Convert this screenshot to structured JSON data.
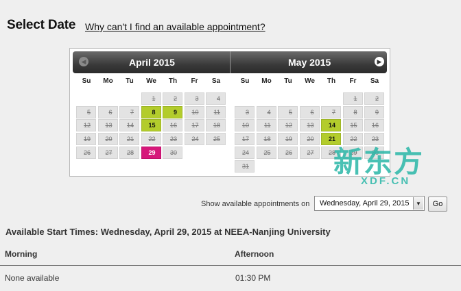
{
  "header": {
    "title": "Select Date",
    "help_link": "Why can't I find an available appointment?"
  },
  "calendar": {
    "weekdays": [
      "Su",
      "Mo",
      "Tu",
      "We",
      "Th",
      "Fr",
      "Sa"
    ],
    "months": [
      {
        "title": "April 2015",
        "weeks": [
          [
            null,
            null,
            null,
            {
              "d": "1",
              "s": "past"
            },
            {
              "d": "2",
              "s": "past"
            },
            {
              "d": "3",
              "s": "past"
            },
            {
              "d": "4",
              "s": "past"
            }
          ],
          [
            {
              "d": "5",
              "s": "past"
            },
            {
              "d": "6",
              "s": "past"
            },
            {
              "d": "7",
              "s": "past"
            },
            {
              "d": "8",
              "s": "available"
            },
            {
              "d": "9",
              "s": "available"
            },
            {
              "d": "10",
              "s": "past"
            },
            {
              "d": "11",
              "s": "past"
            }
          ],
          [
            {
              "d": "12",
              "s": "past"
            },
            {
              "d": "13",
              "s": "past"
            },
            {
              "d": "14",
              "s": "past"
            },
            {
              "d": "15",
              "s": "available"
            },
            {
              "d": "16",
              "s": "past"
            },
            {
              "d": "17",
              "s": "past"
            },
            {
              "d": "18",
              "s": "past"
            }
          ],
          [
            {
              "d": "19",
              "s": "past"
            },
            {
              "d": "20",
              "s": "past"
            },
            {
              "d": "21",
              "s": "past"
            },
            {
              "d": "22",
              "s": "past"
            },
            {
              "d": "23",
              "s": "past"
            },
            {
              "d": "24",
              "s": "past"
            },
            {
              "d": "25",
              "s": "past"
            }
          ],
          [
            {
              "d": "26",
              "s": "past"
            },
            {
              "d": "27",
              "s": "past"
            },
            {
              "d": "28",
              "s": "past"
            },
            {
              "d": "29",
              "s": "selected"
            },
            {
              "d": "30",
              "s": "past"
            },
            null,
            null
          ]
        ]
      },
      {
        "title": "May 2015",
        "weeks": [
          [
            null,
            null,
            null,
            null,
            null,
            {
              "d": "1",
              "s": "past"
            },
            {
              "d": "2",
              "s": "past"
            }
          ],
          [
            {
              "d": "3",
              "s": "past"
            },
            {
              "d": "4",
              "s": "past"
            },
            {
              "d": "5",
              "s": "past"
            },
            {
              "d": "6",
              "s": "past"
            },
            {
              "d": "7",
              "s": "past"
            },
            {
              "d": "8",
              "s": "past"
            },
            {
              "d": "9",
              "s": "past"
            }
          ],
          [
            {
              "d": "10",
              "s": "past"
            },
            {
              "d": "11",
              "s": "past"
            },
            {
              "d": "12",
              "s": "past"
            },
            {
              "d": "13",
              "s": "past"
            },
            {
              "d": "14",
              "s": "available"
            },
            {
              "d": "15",
              "s": "past"
            },
            {
              "d": "16",
              "s": "past"
            }
          ],
          [
            {
              "d": "17",
              "s": "past"
            },
            {
              "d": "18",
              "s": "past"
            },
            {
              "d": "19",
              "s": "past"
            },
            {
              "d": "20",
              "s": "past"
            },
            {
              "d": "21",
              "s": "available"
            },
            {
              "d": "22",
              "s": "past"
            },
            {
              "d": "23",
              "s": "past"
            }
          ],
          [
            {
              "d": "24",
              "s": "past"
            },
            {
              "d": "25",
              "s": "past"
            },
            {
              "d": "26",
              "s": "past"
            },
            {
              "d": "27",
              "s": "past"
            },
            {
              "d": "28",
              "s": "past"
            },
            {
              "d": "29",
              "s": "past"
            },
            {
              "d": "30",
              "s": "past"
            }
          ],
          [
            {
              "d": "31",
              "s": "past"
            },
            null,
            null,
            null,
            null,
            null,
            null
          ]
        ]
      }
    ],
    "prev_icon": "chevron-left-icon",
    "next_icon": "chevron-right-icon"
  },
  "controls": {
    "show_label": "Show available appointments on",
    "date_value": "Wednesday, April 29, 2015",
    "go_label": "Go"
  },
  "availability": {
    "heading": "Available Start Times: Wednesday, April 29, 2015 at NEEA-Nanjing University",
    "columns": [
      "Morning",
      "Afternoon"
    ],
    "morning": "None available",
    "afternoon": "01:30 PM"
  },
  "watermark": {
    "glyphs": [
      "新",
      "东",
      "方"
    ],
    "text": "XDF.CN"
  },
  "colors": {
    "available": "#b3cc2c",
    "selected": "#d6187a",
    "unavailable": "#e3e3e3",
    "watermark": "#2ab7a8"
  }
}
